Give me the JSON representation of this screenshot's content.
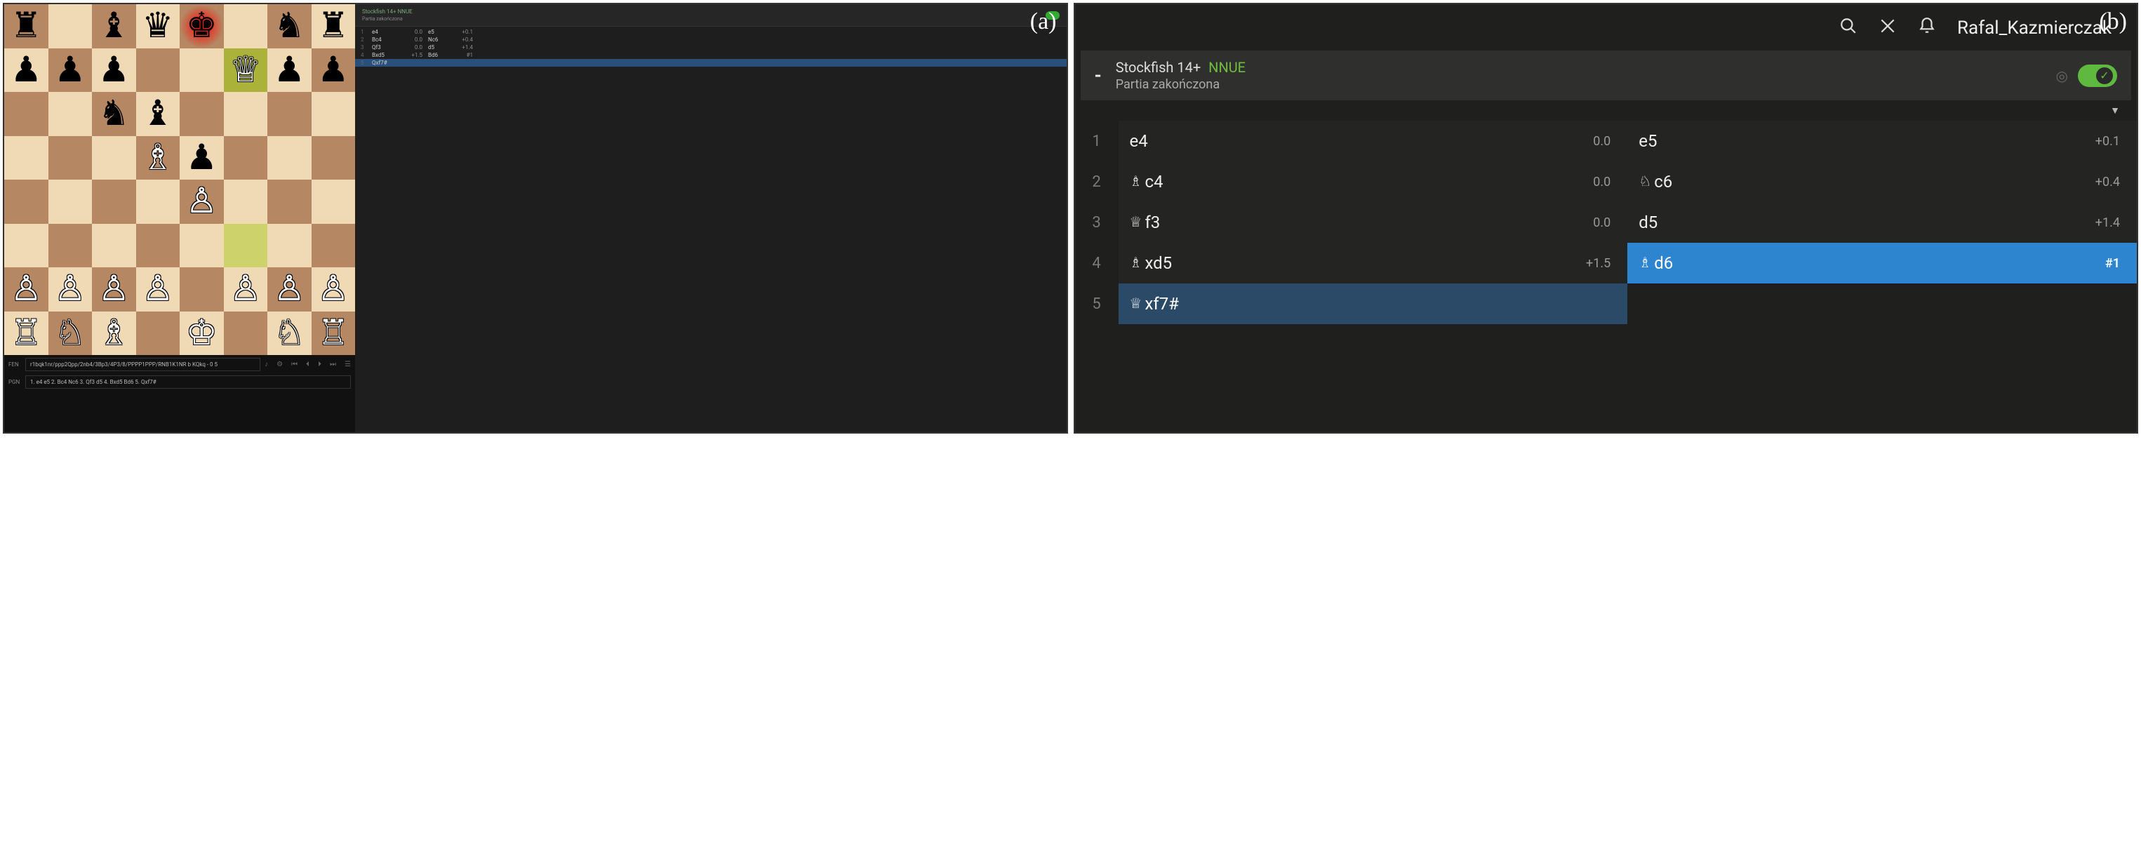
{
  "labels": {
    "a": "(a)",
    "b": "(b)"
  },
  "leftPanel": {
    "board": {
      "orientation": "white",
      "lastMove": {
        "from": "f3",
        "to": "f7"
      },
      "checkSquare": "e8",
      "pieces": {
        "a8": "br",
        "c8": "bb",
        "d8": "bq",
        "e8": "bk",
        "g8": "bn",
        "h8": "br",
        "a7": "bp",
        "b7": "bp",
        "c7": "bp",
        "f7": "wq",
        "g7": "bp",
        "h7": "bp",
        "c6": "bn",
        "d6": "bb",
        "d5": "wb",
        "e5": "bp",
        "e4": "wp",
        "a2": "wp",
        "b2": "wp",
        "c2": "wp",
        "d2": "wp",
        "f2": "wp",
        "g2": "wp",
        "h2": "wp",
        "a1": "wr",
        "b1": "wn",
        "c1": "wb",
        "e1": "wk",
        "g1": "wn",
        "h1": "wr"
      }
    },
    "sideHeader": {
      "engineLine": "Stockfish 14+",
      "engineTag": "NNUE",
      "statusLine": "Partia zakończona"
    },
    "miniMoves": [
      {
        "n": 1,
        "w": "e4",
        "we": "0.0",
        "b": "e5",
        "be": "+0.1"
      },
      {
        "n": 2,
        "w": "Bc4",
        "we": "0.0",
        "b": "Nc6",
        "be": "+0.4"
      },
      {
        "n": 3,
        "w": "Qf3",
        "we": "0.0",
        "b": "d5",
        "be": "+1.4"
      },
      {
        "n": 4,
        "w": "Bxd5",
        "we": "+1.5",
        "b": "Bd6",
        "be": "#1"
      },
      {
        "n": 5,
        "w": "Qxf7#",
        "we": "",
        "b": "",
        "be": ""
      }
    ],
    "underBoard": {
      "fenLabel": "FEN",
      "fenValue": "r1bqk1nr/ppp2Qpp/2nb4/3Bp3/4P3/8/PPPP1PPP/RNB1K1NR b KQkq - 0 5",
      "pgnLabel": "PGN",
      "pgnValue": "1. e4 e5 2. Bc4 Nc6 3. Qf3 d5 4. Bxd5 Bd6 5. Qxf7#"
    }
  },
  "rightPanel": {
    "topbar": {
      "username": "Rafal_Kazmierczak"
    },
    "engineHeader": {
      "dash": "-",
      "engineName": "Stockfish 14+",
      "engineTag": "NNUE",
      "status": "Partia zakończona",
      "toggleOn": true
    },
    "caret": "▼",
    "moves": [
      {
        "n": 1,
        "w": {
          "san": "e4",
          "eval": "0.0"
        },
        "b": {
          "san": "e5",
          "eval": "+0.1"
        }
      },
      {
        "n": 2,
        "w": {
          "icon": "♗",
          "san": "c4",
          "eval": "0.0"
        },
        "b": {
          "icon": "♘",
          "san": "c6",
          "eval": "+0.4"
        }
      },
      {
        "n": 3,
        "w": {
          "icon": "♕",
          "san": "f3",
          "eval": "0.0"
        },
        "b": {
          "san": "d5",
          "eval": "+1.4"
        }
      },
      {
        "n": 4,
        "w": {
          "icon": "♗",
          "san": "xd5",
          "eval": "+1.5"
        },
        "b": {
          "icon": "♗",
          "san": "d6",
          "eval": "#1",
          "highlight": "blue"
        }
      },
      {
        "n": 5,
        "w": {
          "icon": "♕",
          "san": "xf7#",
          "eval": "",
          "highlight": "navy"
        },
        "b": null
      }
    ]
  }
}
